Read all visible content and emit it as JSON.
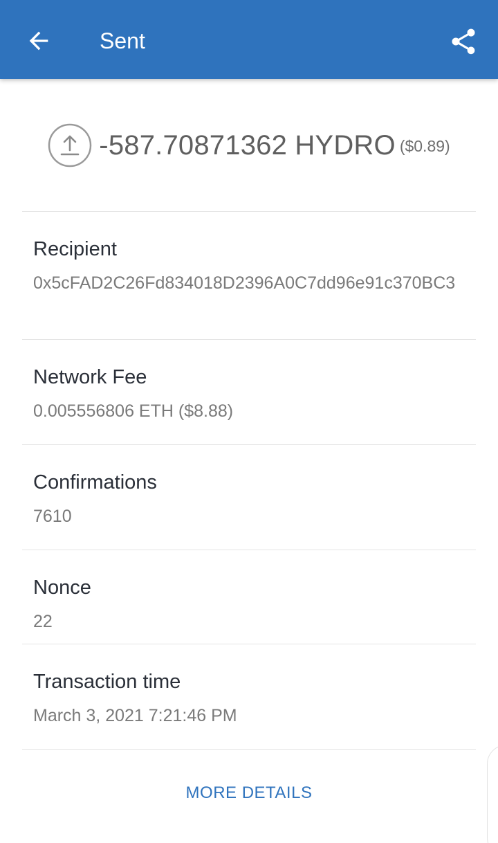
{
  "header": {
    "title": "Sent",
    "back_icon": "arrow-left-icon",
    "share_icon": "share-icon",
    "color": "#2f73bd"
  },
  "summary": {
    "icon": "upload-circle-icon",
    "amount": "-587.70871362 HYDRO",
    "fiat": "($0.89)"
  },
  "details": {
    "recipient": {
      "label": "Recipient",
      "value": "0x5cFAD2C26Fd834018D2396A0C7dd96e91c370BC3"
    },
    "network_fee": {
      "label": "Network Fee",
      "value": "0.005556806 ETH ($8.88)"
    },
    "confirmations": {
      "label": "Confirmations",
      "value": "7610"
    },
    "nonce": {
      "label": "Nonce",
      "value": "22"
    },
    "transaction_time": {
      "label": "Transaction time",
      "value": "March 3, 2021 7:21:46 PM"
    }
  },
  "actions": {
    "more_details": "MORE DETAILS"
  }
}
